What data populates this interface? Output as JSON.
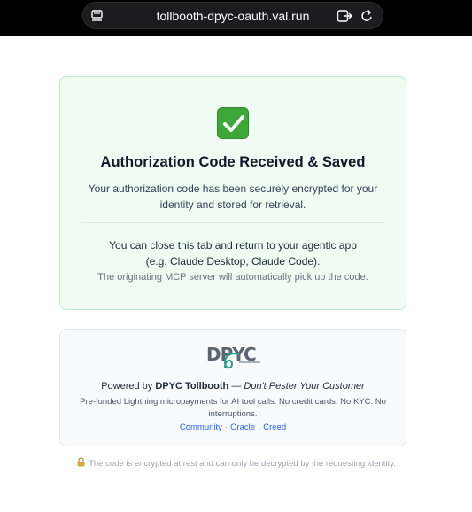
{
  "browser": {
    "url": "tollbooth-dpyc-oauth.val.run"
  },
  "success": {
    "title": "Authorization Code Received & Saved",
    "description": "Your authorization code has been securely encrypted for your identity and stored for retrieval.",
    "close_line1": "You can close this tab and return to your agentic app",
    "close_line2": "(e.g. Claude Desktop, Claude Code).",
    "origin_note": "The originating MCP server will automatically pick up the code."
  },
  "powered": {
    "prefix": "Powered by ",
    "brand": "DPYC Tollbooth",
    "dash": " — ",
    "tagline": "Don't Pester Your Customer",
    "description": "Pre-funded Lightning micropayments for AI tool calls. No credit cards. No KYC. No interruptions.",
    "links": [
      "Community",
      "Oracle",
      "Creed"
    ],
    "separator": "·",
    "logo_text": "DPYC"
  },
  "footer": {
    "note": "The code is encrypted at rest and can only be decrypted by the requesting identity."
  },
  "colors": {
    "success_bg": "#effbf3",
    "success_border": "#bfe9cf",
    "check_green": "#3fa73a",
    "link_blue": "#2563eb"
  },
  "icons": [
    "reader-icon",
    "tab-icon",
    "reload-icon",
    "check-icon",
    "dpyc-logo",
    "lock-icon"
  ]
}
